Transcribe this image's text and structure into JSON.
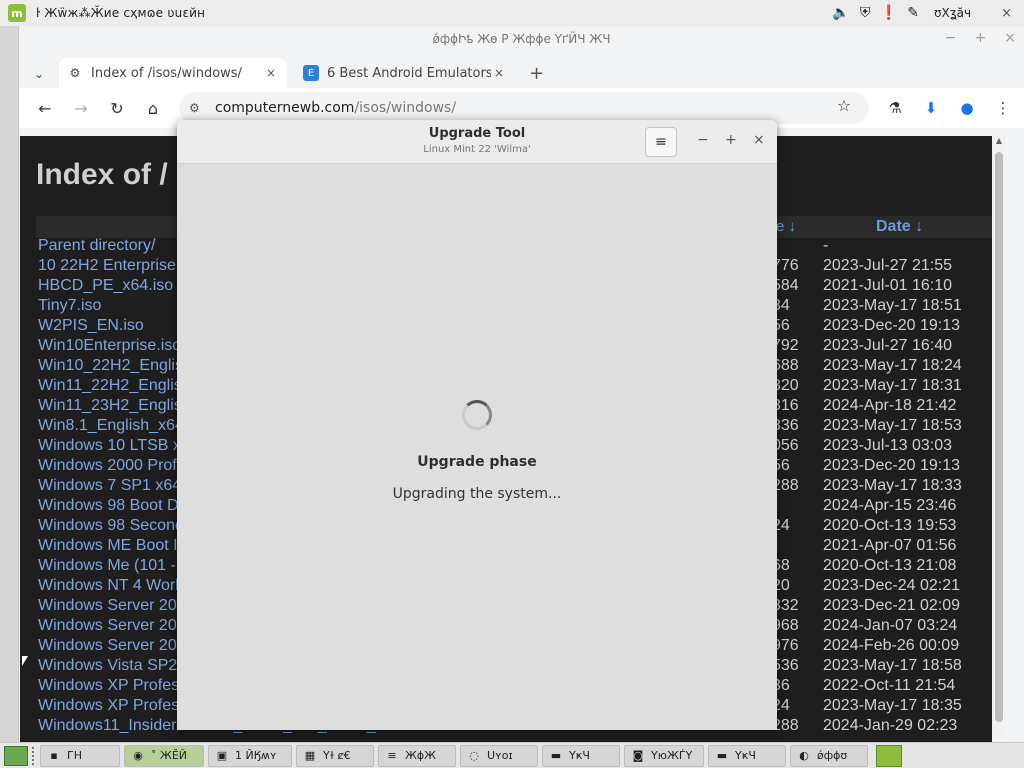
{
  "system_panel": {
    "logo": "m",
    "menu_text": "ŀ Жẅж⁂Ӂиe  cҳмɷe  ʋuɛйн",
    "clock": "ʊХʓӑч",
    "icons": [
      "volume-icon",
      "shield-icon",
      "warning-icon",
      "edit-icon"
    ],
    "close": "×"
  },
  "browser": {
    "window_title": "ǿфɸԻҍ Жɵ Ρ Жфɸе  ҮґӤЧ ЖЧ",
    "window_controls": {
      "minimize": "−",
      "maximize": "+",
      "close": "×"
    },
    "tab_dropdown": "⌄",
    "tabs": [
      {
        "label": "Index of /isos/windows/",
        "icon": "⚙",
        "close": "×"
      },
      {
        "label": "6 Best Android Emulators Fo",
        "icon": "E",
        "close": "×"
      }
    ],
    "new_tab": "+",
    "nav": {
      "back": "←",
      "forward": "→",
      "reload": "↻",
      "home": "⌂"
    },
    "url_host": "computernewb.com",
    "url_path": "/isos/windows/",
    "toolbar_icons": {
      "bookmark": "☆",
      "labs": "⚗",
      "download": "⬇",
      "profile": "●",
      "menu": "⋮"
    }
  },
  "page": {
    "heading": "Index of /",
    "col_size": "e ↓",
    "col_date": "Date  ↓",
    "rows": [
      {
        "name": "Parent directory/",
        "size": "",
        "date": "-"
      },
      {
        "name": "10 22H2 Enterprise",
        "size": "776",
        "date": "2023-Jul-27 21:55"
      },
      {
        "name": "HBCD_PE_x64.iso",
        "size": "584",
        "date": "2021-Jul-01 16:10"
      },
      {
        "name": "Tiny7.iso",
        "size": "34",
        "date": "2023-May-17 18:51"
      },
      {
        "name": "W2PIS_EN.iso",
        "size": "56",
        "date": "2023-Dec-20 19:13"
      },
      {
        "name": "Win10Enterprise.iso",
        "size": "792",
        "date": "2023-Jul-27 16:40"
      },
      {
        "name": "Win10_22H2_Englis",
        "size": "688",
        "date": "2023-May-17 18:24"
      },
      {
        "name": "Win11_22H2_Englis",
        "size": "320",
        "date": "2023-May-17 18:31"
      },
      {
        "name": "Win11_23H2_Englis",
        "size": "316",
        "date": "2024-Apr-18 21:42"
      },
      {
        "name": "Win8.1_English_x64",
        "size": "336",
        "date": "2023-May-17 18:53"
      },
      {
        "name": "Windows 10 LTSB x",
        "size": "056",
        "date": "2023-Jul-13 03:03"
      },
      {
        "name": "Windows 2000 Prof",
        "size": "56",
        "date": "2023-Dec-20 19:13"
      },
      {
        "name": "Windows 7 SP1 x64",
        "size": "288",
        "date": "2023-May-17 18:33"
      },
      {
        "name": "Windows 98 Boot D",
        "size": "",
        "date": "2024-Apr-15 23:46"
      },
      {
        "name": "Windows 98 Second",
        "size": "24",
        "date": "2020-Oct-13 19:53"
      },
      {
        "name": "Windows ME Boot I",
        "size": "",
        "date": "2021-Apr-07 01:56"
      },
      {
        "name": "Windows Me (101 -",
        "size": "68",
        "date": "2020-Oct-13 21:08"
      },
      {
        "name": "Windows NT 4 Work",
        "size": "20",
        "date": "2023-Dec-24 02:21"
      },
      {
        "name": "Windows Server 20",
        "size": "332",
        "date": "2023-Dec-21 02:09"
      },
      {
        "name": "Windows Server 20",
        "size": "968",
        "date": "2024-Jan-07 03:24"
      },
      {
        "name": "Windows Server 20",
        "size": "976",
        "date": "2024-Feb-26 00:09"
      },
      {
        "name": "Windows Vista SP2",
        "size": "536",
        "date": "2023-May-17 18:58"
      },
      {
        "name": "Windows XP Profes",
        "size": "36",
        "date": "2022-Oct-11 21:54"
      },
      {
        "name": "Windows XP Profes",
        "size": "24",
        "date": "2023-May-17 18:35"
      },
      {
        "name": "Windows11_InsiderPreview_Client_x64_en-us_26040.iso",
        "size": "288",
        "date": "2024-Jan-29 02:23"
      }
    ]
  },
  "dialog": {
    "title": "Upgrade Tool",
    "subtitle": "Linux Mint 22 'Wilma'",
    "menu_icon": "≡",
    "minimize": "−",
    "maximize": "+",
    "close": "×",
    "phase": "Upgrade phase",
    "status": "Upgrading the system..."
  },
  "taskbar": {
    "tasks": [
      {
        "label": "ГН",
        "icon": "▪"
      },
      {
        "label": "˚ ЖӖЙ",
        "icon": "◉"
      },
      {
        "label": "1 ЙӃʍʏ",
        "icon": "▣"
      },
      {
        "label": "Yɫ ȼ€",
        "icon": "▦"
      },
      {
        "label": "ЖϕЖ",
        "icon": "≡"
      },
      {
        "label": "Uʏoɪ",
        "icon": "◌"
      },
      {
        "label": "YҝЧ",
        "icon": "▬"
      },
      {
        "label": "YюЖЃY",
        "icon": "◙"
      },
      {
        "label": "YҝЧ",
        "icon": "▬"
      },
      {
        "label": "ǿфɸʊ",
        "icon": "◐"
      }
    ]
  }
}
